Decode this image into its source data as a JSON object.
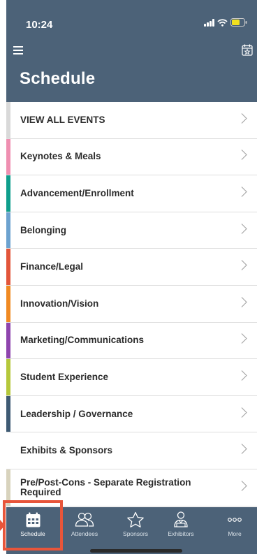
{
  "status_bar": {
    "time": "10:24"
  },
  "header": {
    "title": "Schedule"
  },
  "list": [
    {
      "label": "VIEW ALL EVENTS",
      "color": "#d9d9d9"
    },
    {
      "label": "Keynotes & Meals",
      "color": "#ef8fb1"
    },
    {
      "label": "Advancement/Enrollment",
      "color": "#0f9e8c"
    },
    {
      "label": "Belonging",
      "color": "#6ca2cf"
    },
    {
      "label": "Finance/Legal",
      "color": "#e2553a"
    },
    {
      "label": "Innovation/Vision",
      "color": "#f08a22"
    },
    {
      "label": "Marketing/Communications",
      "color": "#8e44ad"
    },
    {
      "label": "Student Experience",
      "color": "#b5c83b"
    },
    {
      "label": "Leadership / Governance",
      "color": "#3e5a73"
    },
    {
      "label": "Exhibits & Sponsors",
      "color": "#ffffff"
    },
    {
      "label": "Pre/Post-Cons - Separate Registration Required",
      "color": "#d8d3bd"
    }
  ],
  "tabbar": {
    "tabs": [
      {
        "label": "Schedule",
        "icon": "calendar-icon",
        "active": true
      },
      {
        "label": "Attendees",
        "icon": "people-icon",
        "active": false
      },
      {
        "label": "Sponsors",
        "icon": "star-icon",
        "active": false
      },
      {
        "label": "Exhibitors",
        "icon": "exhibitor-icon",
        "active": false
      },
      {
        "label": "More",
        "icon": "more-icon",
        "active": false
      }
    ]
  },
  "colors": {
    "header_bg": "#4c6278",
    "highlight": "#e8553a"
  }
}
